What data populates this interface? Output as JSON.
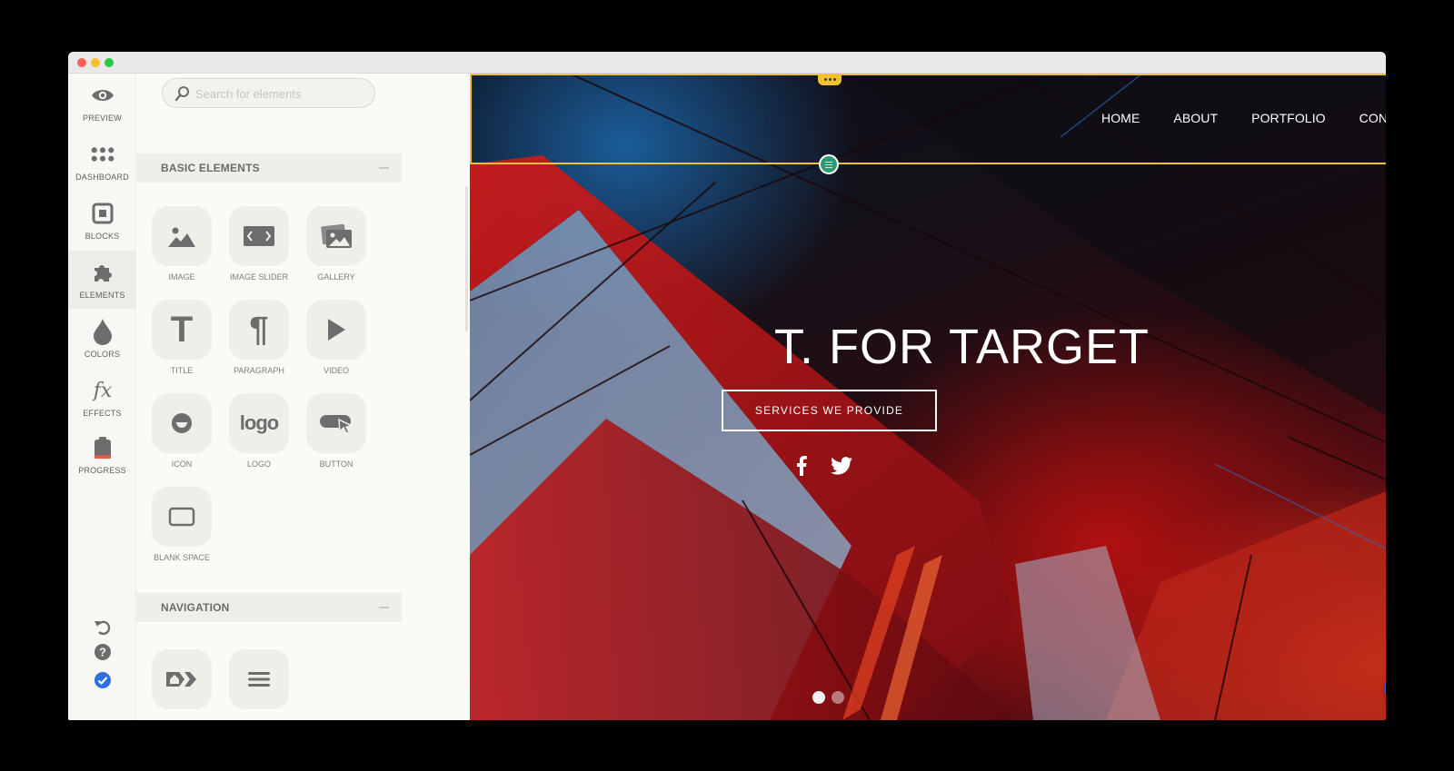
{
  "rail": {
    "items": [
      {
        "label": "PREVIEW",
        "icon": "eye-icon"
      },
      {
        "label": "DASHBOARD",
        "icon": "grid-dots-icon"
      },
      {
        "label": "BLOCKS",
        "icon": "square-block-icon"
      },
      {
        "label": "ELEMENTS",
        "icon": "puzzle-icon",
        "active": true
      },
      {
        "label": "COLORS",
        "icon": "drop-icon"
      },
      {
        "label": "EFFECTS",
        "icon": "fx-icon"
      },
      {
        "label": "PROGRESS",
        "icon": "clipboard-icon"
      }
    ],
    "effects_glyph": "fx"
  },
  "panel": {
    "search_placeholder": "Search for elements",
    "sections": [
      {
        "title": "BASIC ELEMENTS"
      },
      {
        "title": "NAVIGATION"
      }
    ],
    "basic_elements": [
      "IMAGE",
      "IMAGE SLIDER",
      "GALLERY",
      "TITLE",
      "PARAGRAPH",
      "VIDEO",
      "ICON",
      "LOGO",
      "BUTTON",
      "BLANK SPACE"
    ],
    "logo_glyph": "logo",
    "title_glyph": "T",
    "paragraph_glyph": "¶"
  },
  "site": {
    "nav": [
      "HOME",
      "ABOUT",
      "PORTFOLIO",
      "CONTACT"
    ],
    "hero_title": "T. FOR TARGET",
    "hero_button": "SERVICES WE PROVIDE"
  },
  "colors": {
    "selection": "#f2c12e",
    "chat_button": "#2f6fe0",
    "knob": "#2f9a74",
    "active_check": "#2f6fe0"
  }
}
